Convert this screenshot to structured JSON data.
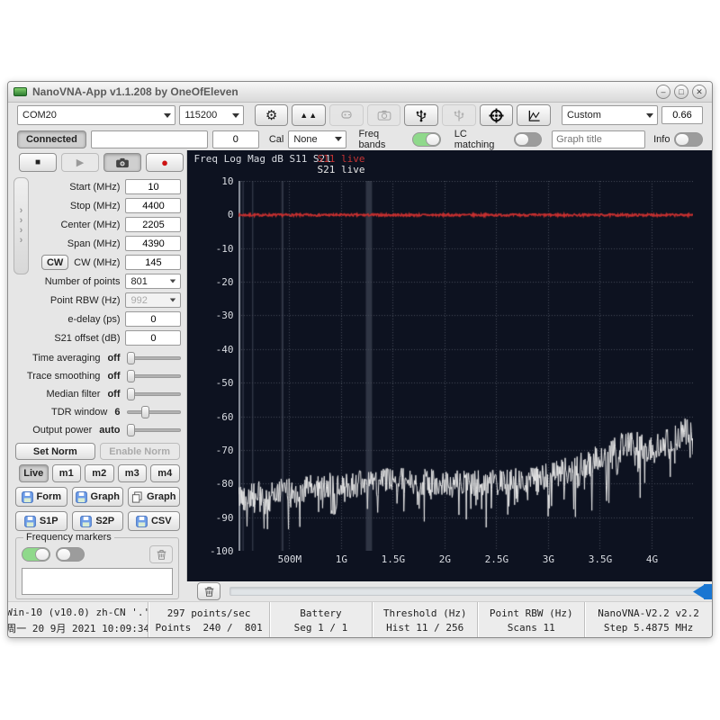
{
  "window": {
    "title": "NanoVNA-App v1.1.208 by OneOfEleven",
    "minimize": "–",
    "maximize": "□",
    "close": "✕"
  },
  "toolbar": {
    "com_port": "COM20",
    "baud_rate": "115200",
    "preset": "Custom",
    "scale_value": "0.66",
    "icons": [
      "gear-icon",
      "double-up-icon",
      "plug-icon-disabled",
      "camera-icon-disabled",
      "usb-icon",
      "usb-icon-disabled",
      "target-icon",
      "chart-icon"
    ]
  },
  "connection_row": {
    "connect_label": "Connected",
    "message_value": "",
    "cal_count": "0",
    "cal_label": "Cal",
    "cal_select": "None",
    "freq_bands_label": "Freq bands",
    "freq_bands_on": true,
    "lc_matching_label": "LC matching",
    "lc_matching_on": false,
    "graph_title_placeholder": "Graph title",
    "info_label": "Info",
    "info_on": false
  },
  "left_panel": {
    "fields": [
      {
        "label": "Start (MHz)",
        "value": "10",
        "type": "input"
      },
      {
        "label": "Stop (MHz)",
        "value": "4400",
        "type": "input"
      },
      {
        "label": "Center (MHz)",
        "value": "2205",
        "type": "input"
      },
      {
        "label": "Span (MHz)",
        "value": "4390",
        "type": "input"
      },
      {
        "label": "CW (MHz)",
        "value": "145",
        "type": "input",
        "prefix_button": "CW"
      },
      {
        "label": "Number of points",
        "value": "801",
        "type": "select"
      },
      {
        "label": "Point RBW (Hz)",
        "value": "992",
        "type": "select",
        "disabled": true
      },
      {
        "label": "e-delay (ps)",
        "value": "0",
        "type": "input"
      },
      {
        "label": "S21 offset (dB)",
        "value": "0",
        "type": "input"
      }
    ],
    "sliders": [
      {
        "label": "Time averaging",
        "value": "off",
        "pos": 0
      },
      {
        "label": "Trace smoothing",
        "value": "off",
        "pos": 0
      },
      {
        "label": "Median filter",
        "value": "off",
        "pos": 0
      },
      {
        "label": "TDR window",
        "value": "6",
        "pos": 0.32
      },
      {
        "label": "Output power",
        "value": "auto",
        "pos": 0
      }
    ],
    "norm_buttons": [
      {
        "label": "Set Norm",
        "disabled": false
      },
      {
        "label": "Enable Norm",
        "disabled": true
      }
    ],
    "memory_tabs": [
      {
        "label": "Live",
        "active": true
      },
      {
        "label": "m1",
        "active": false
      },
      {
        "label": "m2",
        "active": false
      },
      {
        "label": "m3",
        "active": false
      },
      {
        "label": "m4",
        "active": false
      }
    ],
    "save_buttons": [
      {
        "label": "Form",
        "icon": "floppy-icon"
      },
      {
        "label": "Graph",
        "icon": "floppy-icon"
      },
      {
        "label": "Graph",
        "icon": "copy-icon"
      }
    ],
    "export_buttons": [
      {
        "label": "S1P",
        "icon": "floppy-icon"
      },
      {
        "label": "S2P",
        "icon": "floppy-icon"
      },
      {
        "label": "CSV",
        "icon": "floppy-icon"
      }
    ],
    "markers_group": {
      "label": "Frequency markers",
      "toggle1_on": true,
      "toggle2_on": false,
      "list_items": []
    }
  },
  "chart": {
    "type": "line",
    "header": "Freq Log Mag dB S11 S21",
    "legend": [
      {
        "label": "S11 live",
        "color": "#c63434"
      },
      {
        "label": "S21 live",
        "color": "#e8e8e8"
      }
    ],
    "x_min_mhz": 10,
    "x_max_mhz": 4400,
    "y_max_db": 10,
    "y_min_db": -100,
    "y_ticks": [
      "10",
      "0",
      "-10",
      "-20",
      "-30",
      "-40",
      "-50",
      "-60",
      "-70",
      "-80",
      "-90",
      "-100"
    ],
    "x_ticks": [
      {
        "label": "500M",
        "mhz": 500
      },
      {
        "label": "1G",
        "mhz": 1000
      },
      {
        "label": "1.5G",
        "mhz": 1500
      },
      {
        "label": "2G",
        "mhz": 2000
      },
      {
        "label": "2.5G",
        "mhz": 2500
      },
      {
        "label": "3G",
        "mhz": 3000
      },
      {
        "label": "3.5G",
        "mhz": 3500
      },
      {
        "label": "4G",
        "mhz": 4000
      }
    ],
    "band_markers_mhz": [
      [
        10,
        30
      ],
      [
        48,
        56
      ],
      [
        140,
        152
      ],
      [
        425,
        445
      ],
      [
        1240,
        1300
      ]
    ],
    "s11_level_db": 0,
    "s21_envelope": [
      [
        10,
        -84
      ],
      [
        300,
        -83
      ],
      [
        800,
        -81
      ],
      [
        1200,
        -80
      ],
      [
        1600,
        -79
      ],
      [
        2000,
        -80
      ],
      [
        2400,
        -80
      ],
      [
        2800,
        -79
      ],
      [
        3100,
        -77
      ],
      [
        3400,
        -74
      ],
      [
        3600,
        -70
      ],
      [
        3800,
        -68
      ],
      [
        4000,
        -70
      ],
      [
        4200,
        -67
      ],
      [
        4400,
        -63
      ]
    ],
    "points": 801,
    "colors": {
      "bg": "#0d1220",
      "grid": "#474c59",
      "axis": "#8b919c",
      "band": "rgba(135,145,160,0.28)",
      "s11": "#c62f2f",
      "s21": "#e7e7e7"
    }
  },
  "scroll_row": {
    "handle_color": "#1976d2"
  },
  "statusbar": {
    "columns": [
      {
        "top": "Win-10 (v10.0) zh-CN '.'",
        "bottom": "周一 20 9月 2021 10:09:34"
      },
      {
        "top": "297 points/sec",
        "bottom": "Points  240 /  801"
      },
      {
        "top": "Battery",
        "bottom": "Seg 1 / 1"
      },
      {
        "top": "Threshold (Hz)",
        "bottom": "Hist 11 / 256"
      },
      {
        "top": "Point RBW (Hz)",
        "bottom": "Scans 11"
      },
      {
        "top": "NanoVNA-V2.2 v2.2",
        "bottom": "Step 5.4875 MHz"
      }
    ]
  }
}
